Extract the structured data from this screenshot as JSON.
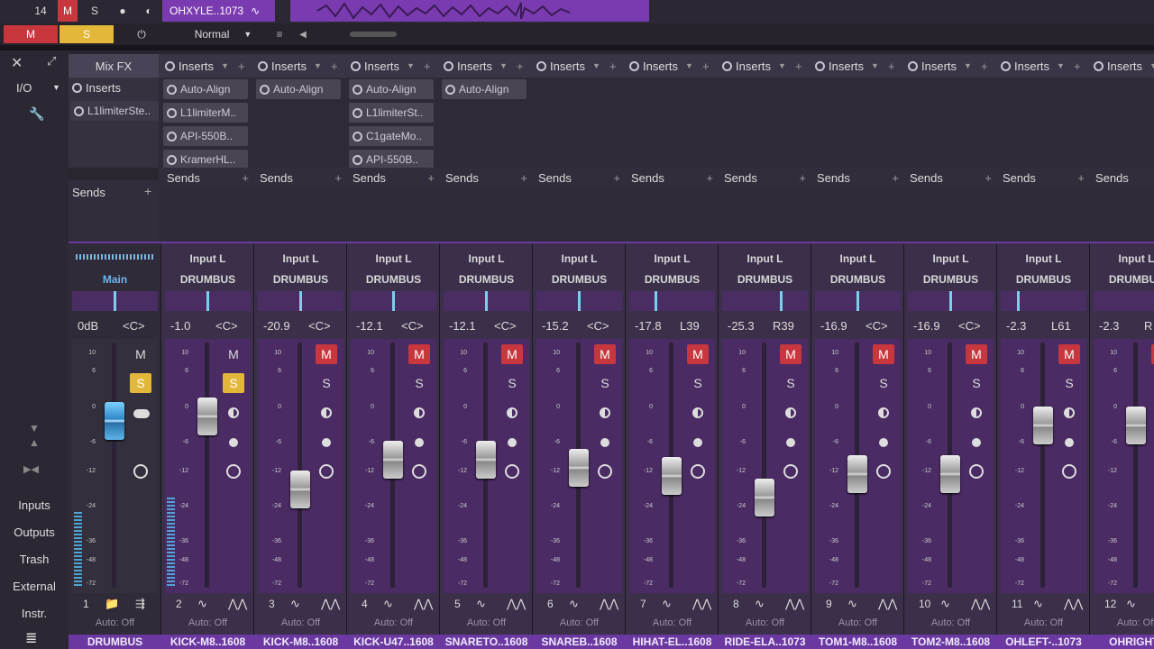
{
  "top": {
    "track_number": "14",
    "mute": "M",
    "solo": "S",
    "event_name": "OHXYLE..1073",
    "row2_mute": "M",
    "row2_solo": "S",
    "mode": "Normal"
  },
  "mix": {
    "mixfx": "Mix FX",
    "inserts_label": "Inserts",
    "sends_label": "Sends",
    "io": "I/O"
  },
  "sidebar": {
    "items": [
      "Inputs",
      "Outputs",
      "Trash",
      "External",
      "Instr."
    ]
  },
  "main_inserts": [
    "L1limiterSte.."
  ],
  "insert_cols": [
    [
      "Auto-Align",
      "L1limiterM..",
      "API-550B..",
      "KramerHL.."
    ],
    [
      "Auto-Align"
    ],
    [
      "Auto-Align",
      "L1limiterSt..",
      "C1gateMo..",
      "API-550B.."
    ],
    [
      "Auto-Align"
    ]
  ],
  "scale": [
    "10",
    "6",
    "0",
    "-6",
    "-12",
    "-24",
    "-36",
    "-48",
    "-72"
  ],
  "main_channel": {
    "label": "Main",
    "volume": "0dB",
    "pan": "<C>",
    "number": "1",
    "auto": "Auto: Off",
    "name": "DRUMBUS",
    "fader_level": 0.72
  },
  "channels": [
    {
      "input": "Input L",
      "bus": "DRUMBUS",
      "volume": "-1.0",
      "pan": "<C>",
      "mute": false,
      "solo": true,
      "number": "2",
      "auto": "Auto: Off",
      "name": "KICK-M8..1608",
      "fader_level": 0.74,
      "pan_pos": 0.5
    },
    {
      "input": "Input L",
      "bus": "DRUMBUS",
      "volume": "-20.9",
      "pan": "<C>",
      "mute": true,
      "solo": false,
      "number": "3",
      "auto": "Auto: Off",
      "name": "KICK-M8..1608",
      "fader_level": 0.4,
      "pan_pos": 0.5
    },
    {
      "input": "Input L",
      "bus": "DRUMBUS",
      "volume": "-12.1",
      "pan": "<C>",
      "mute": true,
      "solo": false,
      "number": "4",
      "auto": "Auto: Off",
      "name": "KICK-U47..1608",
      "fader_level": 0.54,
      "pan_pos": 0.5
    },
    {
      "input": "Input L",
      "bus": "DRUMBUS",
      "volume": "-12.1",
      "pan": "<C>",
      "mute": true,
      "solo": false,
      "number": "5",
      "auto": "Auto: Off",
      "name": "SNARETO..1608",
      "fader_level": 0.54,
      "pan_pos": 0.5
    },
    {
      "input": "Input L",
      "bus": "DRUMBUS",
      "volume": "-15.2",
      "pan": "<C>",
      "mute": true,
      "solo": false,
      "number": "6",
      "auto": "Auto: Off",
      "name": "SNAREB..1608",
      "fader_level": 0.5,
      "pan_pos": 0.5
    },
    {
      "input": "Input L",
      "bus": "DRUMBUS",
      "volume": "-17.8",
      "pan": "L39",
      "mute": true,
      "solo": false,
      "number": "7",
      "auto": "Auto: Off",
      "name": "HIHAT-EL..1608",
      "fader_level": 0.46,
      "pan_pos": 0.3
    },
    {
      "input": "Input L",
      "bus": "DRUMBUS",
      "volume": "-25.3",
      "pan": "R39",
      "mute": true,
      "solo": false,
      "number": "8",
      "auto": "Auto: Off",
      "name": "RIDE-ELA..1073",
      "fader_level": 0.36,
      "pan_pos": 0.7
    },
    {
      "input": "Input L",
      "bus": "DRUMBUS",
      "volume": "-16.9",
      "pan": "<C>",
      "mute": true,
      "solo": false,
      "number": "9",
      "auto": "Auto: Off",
      "name": "TOM1-M8..1608",
      "fader_level": 0.47,
      "pan_pos": 0.5
    },
    {
      "input": "Input L",
      "bus": "DRUMBUS",
      "volume": "-16.9",
      "pan": "<C>",
      "mute": true,
      "solo": false,
      "number": "10",
      "auto": "Auto: Off",
      "name": "TOM2-M8..1608",
      "fader_level": 0.47,
      "pan_pos": 0.5
    },
    {
      "input": "Input L",
      "bus": "DRUMBUS",
      "volume": "-2.3",
      "pan": "L61",
      "mute": true,
      "solo": false,
      "number": "11",
      "auto": "Auto: Off",
      "name": "OHLEFT-..1073",
      "fader_level": 0.7,
      "pan_pos": 0.2
    },
    {
      "input": "Input L",
      "bus": "DRUMBUS",
      "volume": "-2.3",
      "pan": "R",
      "mute": true,
      "solo": false,
      "number": "12",
      "auto": "Auto: Off",
      "name": "OHRIGHT..",
      "fader_level": 0.7,
      "pan_pos": 0.8
    }
  ]
}
